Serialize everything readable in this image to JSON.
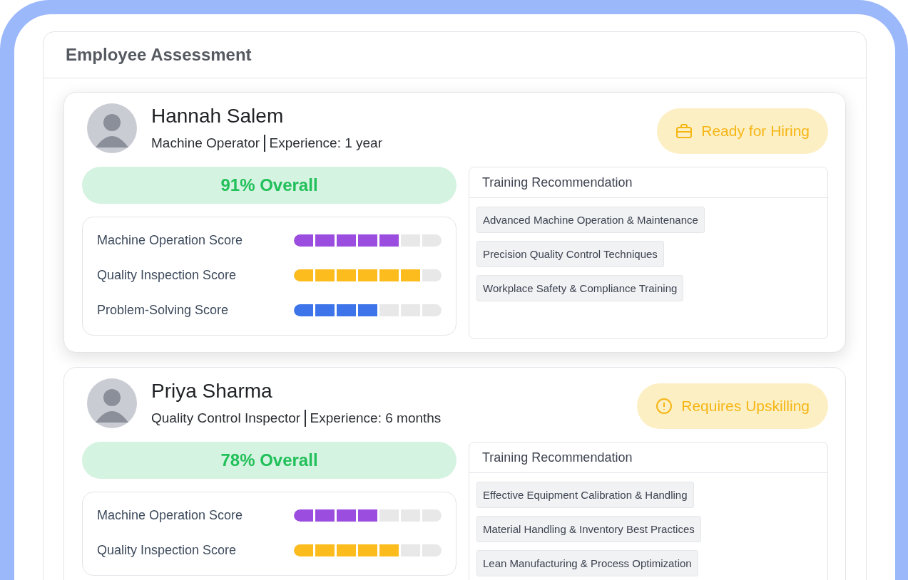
{
  "panel": {
    "title": "Employee Assessment"
  },
  "employees": [
    {
      "name": "Hannah Salem",
      "role": "Machine Operator",
      "experience": "Experience: 1 year",
      "status": {
        "kind": "hiring",
        "label": "Ready for Hiring"
      },
      "overall": "91% Overall",
      "scores": [
        {
          "label": "Machine Operation Score",
          "level": 0.714,
          "color": "#9b4de0"
        },
        {
          "label": "Quality Inspection Score",
          "level": 0.857,
          "color": "#fcbc1e"
        },
        {
          "label": "Problem-Solving Score",
          "level": 0.571,
          "color": "#3d74ea"
        }
      ],
      "training": {
        "title": "Training Recommendation",
        "items": [
          "Advanced Machine Operation & Maintenance",
          "Precision Quality Control Techniques",
          "Workplace Safety & Compliance Training"
        ]
      }
    },
    {
      "name": "Priya Sharma",
      "role": "Quality Control Inspector",
      "experience": "Experience: 6 months",
      "status": {
        "kind": "upskilling",
        "label": "Requires Upskilling"
      },
      "overall": "78% Overall",
      "scores": [
        {
          "label": "Machine Operation Score",
          "level": 0.571,
          "color": "#9b4de0"
        },
        {
          "label": "Quality Inspection Score",
          "level": 0.714,
          "color": "#fcbc1e"
        }
      ],
      "training": {
        "title": "Training Recommendation",
        "items": [
          "Effective Equipment Calibration & Handling",
          "Material Handling & Inventory Best Practices",
          "Lean Manufacturing & Process Optimization"
        ]
      }
    }
  ]
}
